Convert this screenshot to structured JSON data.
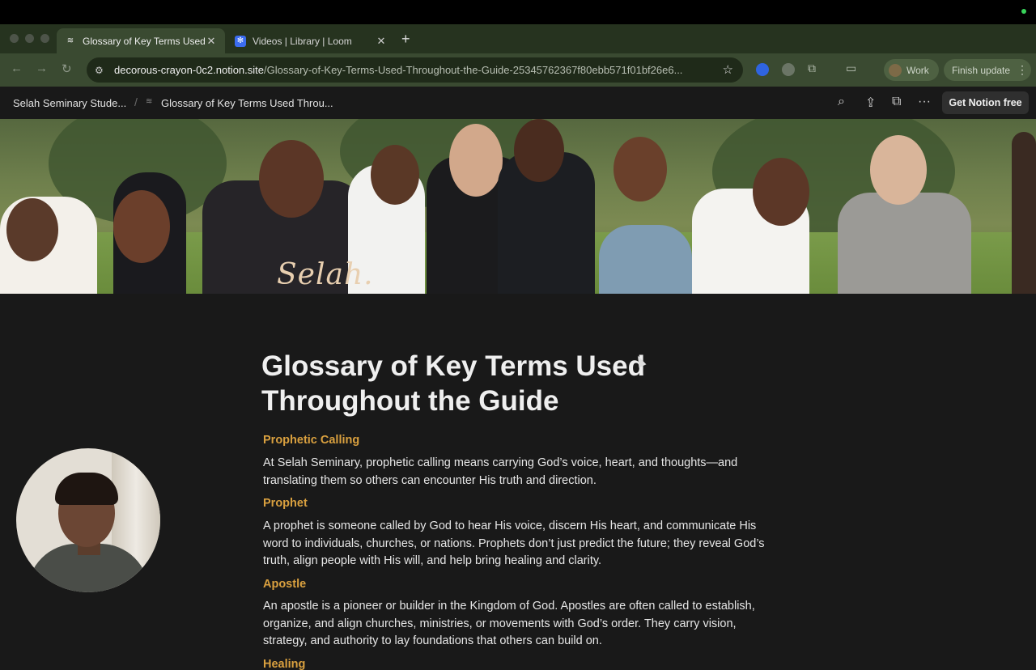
{
  "browser": {
    "tabs": [
      {
        "label": "Glossary of Key Terms Used T",
        "icon": "notion-page-icon",
        "active": true
      },
      {
        "label": "Videos | Library | Loom",
        "icon": "loom-icon",
        "active": false
      }
    ],
    "url_host": "decorous-crayon-0c2.notion.site",
    "url_path": "/Glossary-of-Key-Terms-Used-Throughout-the-Guide-25345762367f80ebb571f01bf26e6...",
    "profile_label": "Work",
    "update_label": "Finish update"
  },
  "notion_header": {
    "breadcrumb_parent": "Selah Seminary Stude...",
    "breadcrumb_current": "Glossary of Key Terms Used Throu...",
    "cta_label": "Get Notion free"
  },
  "cover": {
    "logo_text": "Selah."
  },
  "page": {
    "title": "Glossary of Key Terms Used Throughout the Guide",
    "terms": [
      {
        "heading": "Prophetic Calling",
        "body": "At Selah Seminary, prophetic calling means carrying God’s voice, heart, and thoughts—and translating them so others can encounter His truth and direction."
      },
      {
        "heading": "Prophet",
        "body": "A prophet is someone called by God to hear His voice, discern His heart, and communicate His word to individuals, churches, or nations. Prophets don’t just predict the future; they reveal God’s truth, align people with His will, and help bring healing and clarity."
      },
      {
        "heading": "Apostle",
        "body": "An apostle is a pioneer or builder in the Kingdom of God. Apostles are often called to establish, organize, and align churches, ministries, or movements with God’s order. They carry vision, strategy, and authority to lay foundations that others can build on."
      },
      {
        "heading": "Healing",
        "body": ""
      }
    ]
  },
  "colors": {
    "accent_heading": "#d9a03f",
    "page_bg": "#191919",
    "browser_frame": "#3a4a31"
  }
}
